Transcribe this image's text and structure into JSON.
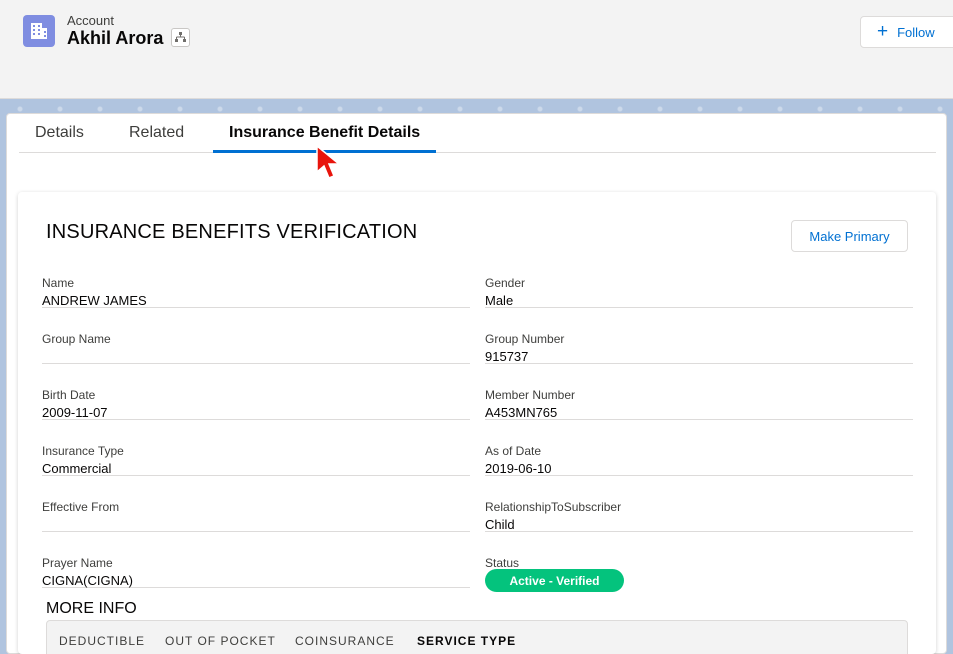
{
  "header": {
    "object_label": "Account",
    "record_name": "Akhil Arora",
    "follow_label": "Follow",
    "follow_icon": "plus-icon",
    "object_icon": "building-icon",
    "hierarchy_icon": "hierarchy-icon"
  },
  "tabs": [
    {
      "label": "Details",
      "active": false
    },
    {
      "label": "Related",
      "active": false
    },
    {
      "label": "Insurance Benefit Details",
      "active": true
    }
  ],
  "panel": {
    "title": "INSURANCE BENEFITS VERIFICATION",
    "make_primary_label": "Make Primary",
    "fields_left": [
      {
        "label": "Name",
        "value": "ANDREW JAMES"
      },
      {
        "label": "Group Name",
        "value": ""
      },
      {
        "label": "Birth Date",
        "value": "2009-11-07"
      },
      {
        "label": "Insurance Type",
        "value": "Commercial"
      },
      {
        "label": "Effective From",
        "value": ""
      },
      {
        "label": "Prayer Name",
        "value": "CIGNA(CIGNA)"
      }
    ],
    "fields_right": [
      {
        "label": "Gender",
        "value": "Male"
      },
      {
        "label": "Group Number",
        "value": "915737"
      },
      {
        "label": "Member Number",
        "value": "A453MN765"
      },
      {
        "label": "As of Date",
        "value": "2019-06-10"
      },
      {
        "label": "RelationshipToSubscriber",
        "value": "Child"
      },
      {
        "label": "Status",
        "value": "Active - Verified"
      }
    ],
    "more_info_label": "MORE INFO",
    "subtabs": [
      {
        "label": "DEDUCTIBLE",
        "active": false
      },
      {
        "label": "OUT OF POCKET",
        "active": false
      },
      {
        "label": "COINSURANCE",
        "active": false
      },
      {
        "label": "SERVICE TYPE",
        "active": true
      }
    ]
  },
  "colors": {
    "brand_blue": "#0070d2",
    "status_green": "#04c37d",
    "account_icon_bg": "#7f8de1",
    "cursor_red": "#e8140c"
  }
}
